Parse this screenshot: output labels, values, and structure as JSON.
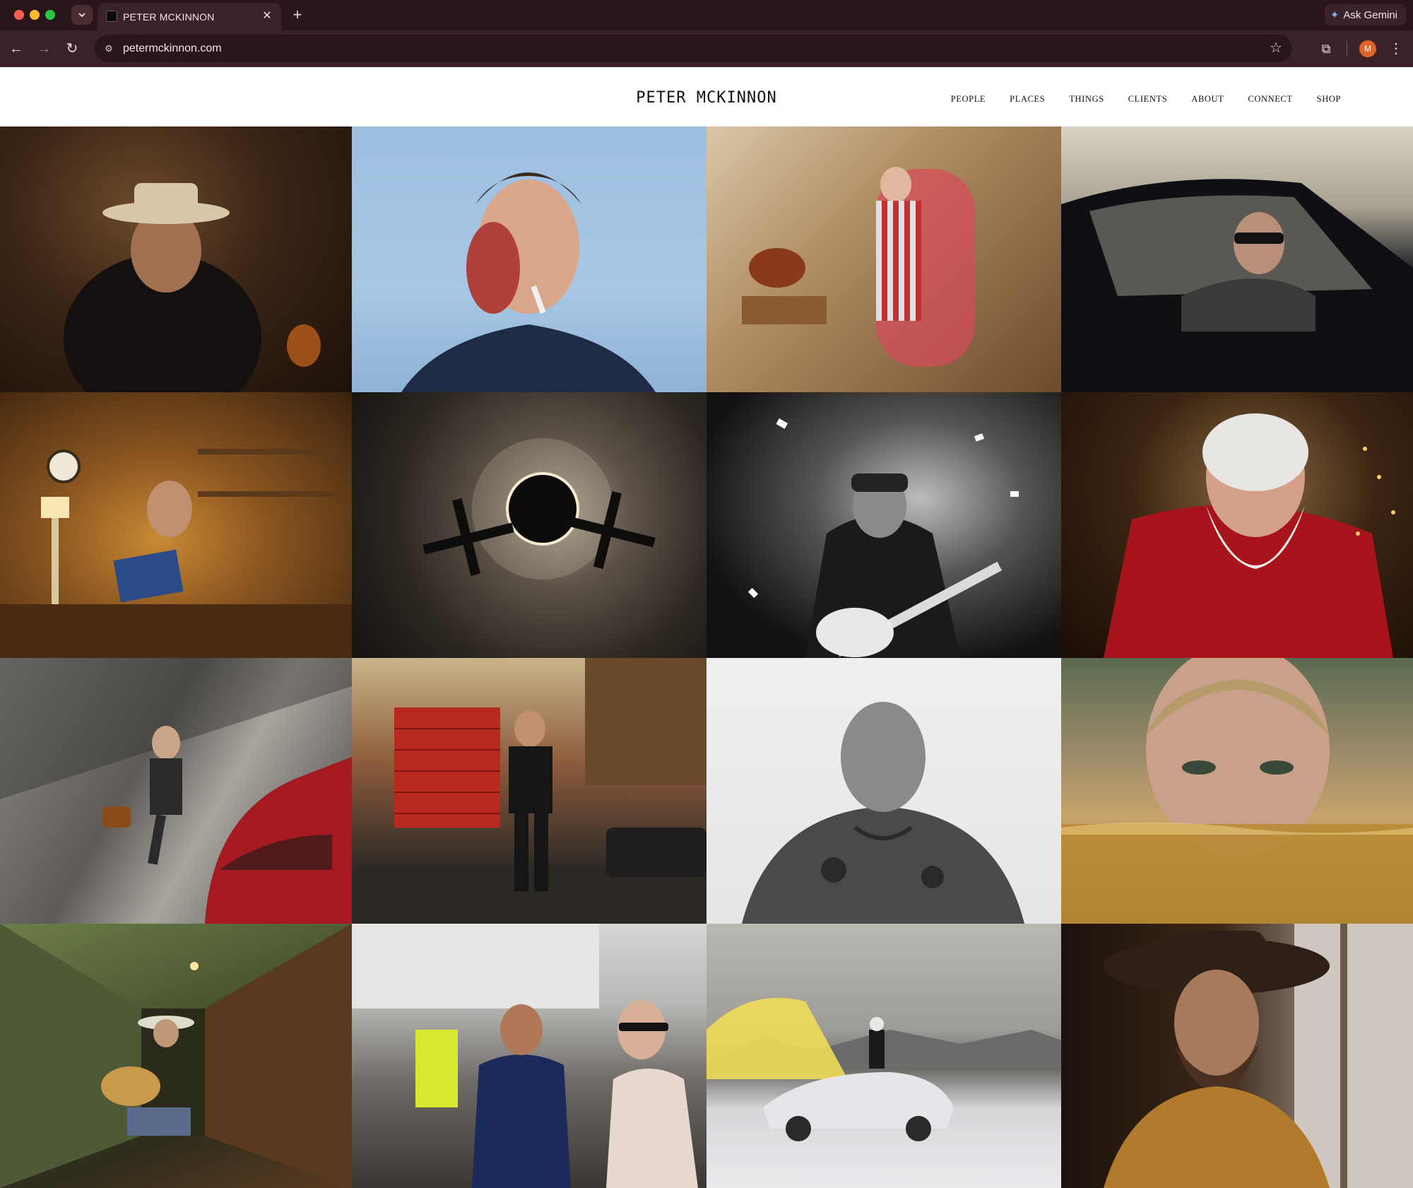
{
  "browser": {
    "tab_title": "PETER MCKINNON",
    "url": "petermckinnon.com",
    "ask_gemini_label": "Ask Gemini",
    "profile_initial": "M"
  },
  "site": {
    "logo": "PETER MCKINNON",
    "nav": [
      "PEOPLE",
      "PLACES",
      "THINGS",
      "CLIENTS",
      "ABOUT",
      "CONNECT",
      "SHOP"
    ]
  },
  "gallery": {
    "count": 16
  }
}
